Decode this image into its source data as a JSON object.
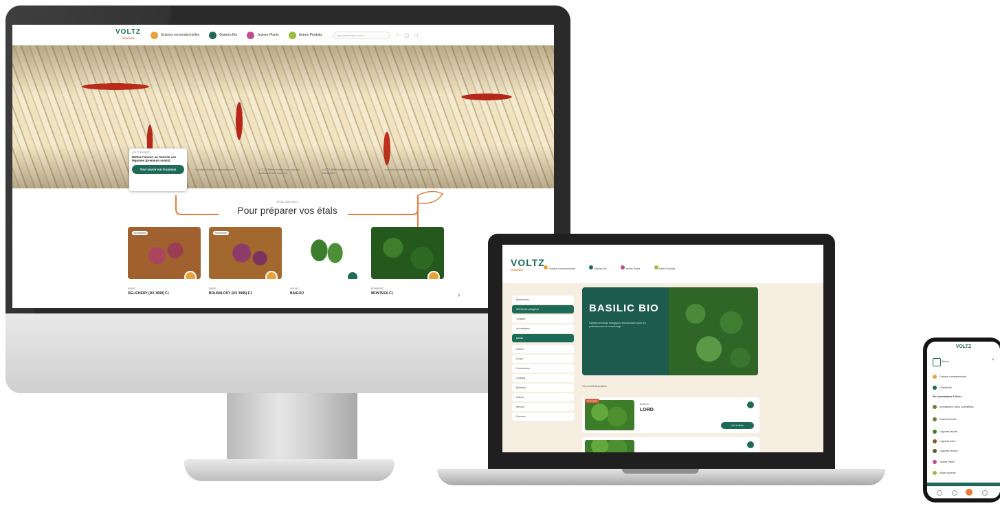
{
  "brand": {
    "logo": "VOLTZ",
    "tagline": "GRAINES",
    "accent_color": "#1d6a57",
    "orange_color": "#e97c37"
  },
  "desktop": {
    "nav": {
      "items": [
        {
          "label": "Graines conventionnelles",
          "icon": "seed-icon",
          "color": "#e9a23b"
        },
        {
          "label": "Graines Bio",
          "icon": "leaf-icon",
          "color": "#1d6a57"
        },
        {
          "label": "Jeunes Plants",
          "icon": "flower-icon",
          "color": "#c04d8f"
        },
        {
          "label": "Autres Produits",
          "icon": "sprout-icon",
          "color": "#9bbf3a"
        }
      ],
      "search_placeholder": "Que recherchez-vous ?"
    },
    "promo": {
      "kicker": "VOLTZ EXPERT",
      "title": "Mettez l'amour au fond de vos légumes (premium suivis)",
      "button": "Tout savoir sur le panais"
    },
    "info_cells": [
      "Variétés d'hiver et de printemps",
      "VOLTZ Référencées pour tous les professionnels légumes",
      "VOLTZ Référencées pour la production maraîchère",
      "Les spécialités du mois pour toute la saison"
    ],
    "section": {
      "label": "SÉLECTION VOLTZ",
      "title": "Pour préparer vos étals"
    },
    "products": [
      {
        "badge": "Nouveauté",
        "category": "RADIS",
        "name": "DELICHERY (DX 3099) F1"
      },
      {
        "badge": "Nouveauté",
        "category": "RADIS",
        "name": "BOLBALOSY (DX 3085) F1"
      },
      {
        "badge": "",
        "category": "CHOUX",
        "name": "BAIGOU"
      },
      {
        "badge": "",
        "category": "ÉPINARDS",
        "name": "MONTESA F1"
      }
    ]
  },
  "laptop": {
    "logo": "VOLTZ",
    "nav_items": [
      "Graines conventionnelles",
      "Graines Bio",
      "Jeunes Plants",
      "Autres Produits"
    ],
    "sidebar": [
      "Nouveautés",
      "Semences potagères",
      "Tomates",
      "Aromatiques",
      "Basilic",
      "Céleris",
      "Choux",
      "Concombres",
      "Courges",
      "Épinards",
      "Laitues",
      "Melons",
      "Poivrons"
    ],
    "banner": {
      "title": "BASILIC BIO",
      "text": "Variétés de basilic biologiques sélectionnées pour les professionnels du maraîchage."
    },
    "results_count": "13 produits disponibles",
    "listing": {
      "badge": "Nouveauté",
      "category": "BASILIC",
      "name": "LORD",
      "button": "Voir la fiche"
    }
  },
  "phone": {
    "logo": "VOLTZ",
    "menu_title": "Menu",
    "rows": [
      {
        "label": "Graines conventionnelles",
        "color": "#e9a23b"
      },
      {
        "label": "Graines Bio",
        "color": "#1d6a57"
      },
      {
        "label": "Bio, aromatiques & fleurs",
        "color": "#1d6a57"
      },
      {
        "label": "Aromatiques, fleurs comestibles",
        "color": "#8a6d3b"
      },
      {
        "label": "Graines fleuries",
        "color": "#6b7b3a"
      },
      {
        "label": "Légumes feuilles",
        "color": "#4b7b2a"
      },
      {
        "label": "Légumes fruits",
        "color": "#7a5a2a"
      },
      {
        "label": "Légumes racines",
        "color": "#55602a"
      },
      {
        "label": "Jeunes Plants",
        "color": "#c04d8f"
      },
      {
        "label": "Autres produits",
        "color": "#9bbf3a"
      }
    ]
  }
}
